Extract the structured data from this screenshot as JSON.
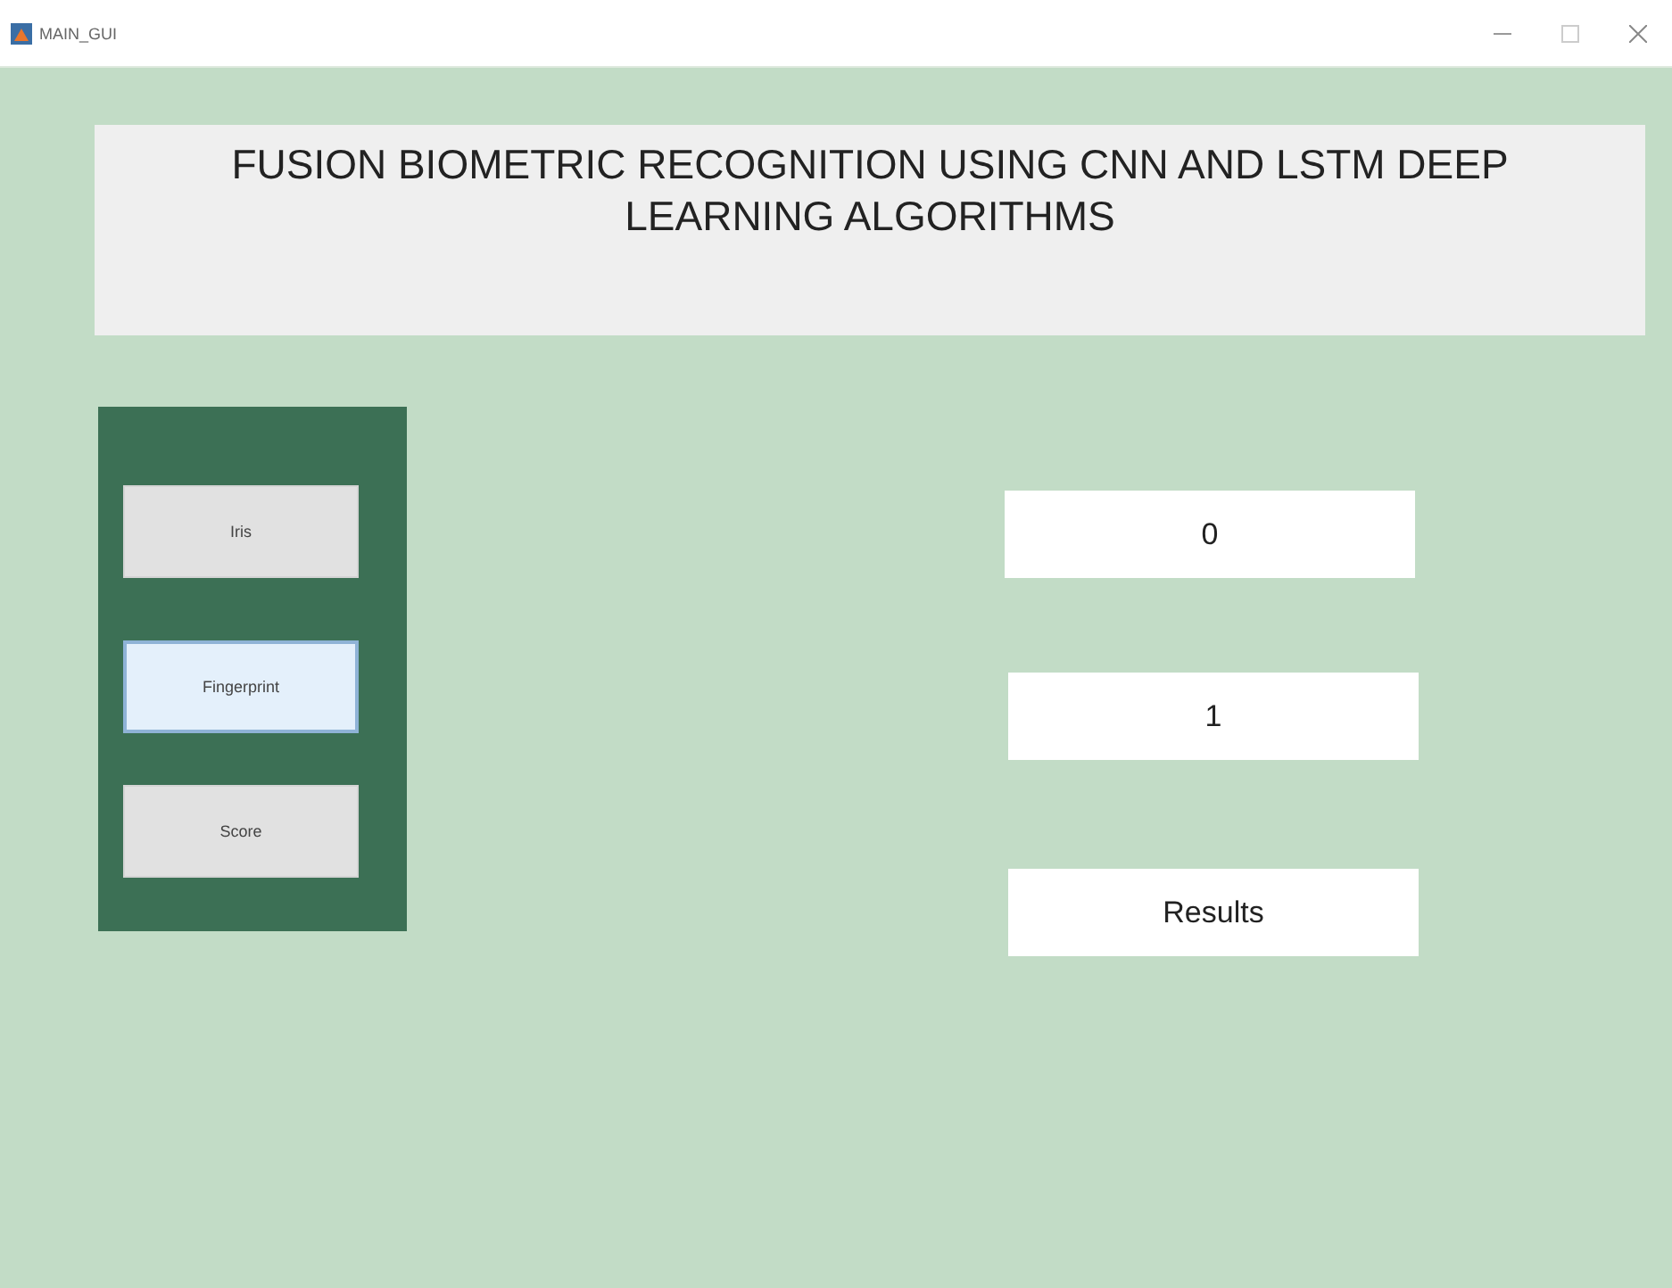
{
  "window": {
    "title": "MAIN_GUI"
  },
  "heading": "FUSION  BIOMETRIC RECOGNITION USING CNN AND LSTM DEEP LEARNING ALGORITHMS",
  "buttons": [
    {
      "label": "Iris",
      "focused": false
    },
    {
      "label": "Fingerprint",
      "focused": true
    },
    {
      "label": "Score",
      "focused": false
    }
  ],
  "outputs": [
    {
      "value": "0"
    },
    {
      "value": "1"
    },
    {
      "value": "Results"
    }
  ]
}
